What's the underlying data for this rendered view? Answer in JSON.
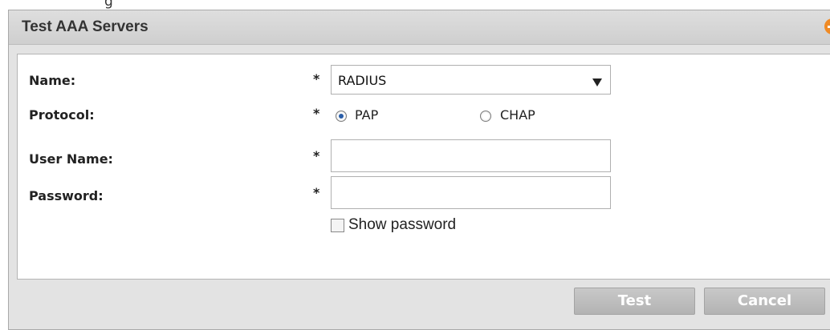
{
  "top_partial_text": "g",
  "dialog": {
    "title": "Test AAA Servers",
    "collapse_icon": "minus-circle-icon",
    "accent_color": "#f08a24"
  },
  "form": {
    "name": {
      "label": "Name:",
      "required": "*",
      "value": "RADIUS",
      "dropdown_icon": "chevron-down-icon"
    },
    "protocol": {
      "label": "Protocol:",
      "required": "*",
      "options": [
        {
          "label": "PAP",
          "checked": true
        },
        {
          "label": "CHAP",
          "checked": false
        }
      ]
    },
    "username": {
      "label": "User Name:",
      "required": "*",
      "value": "",
      "placeholder": ""
    },
    "password": {
      "label": "Password:",
      "required": "*",
      "value": "",
      "placeholder": ""
    },
    "show_password": {
      "label": "Show password",
      "checked": false
    }
  },
  "buttons": {
    "test": "Test",
    "cancel": "Cancel"
  }
}
